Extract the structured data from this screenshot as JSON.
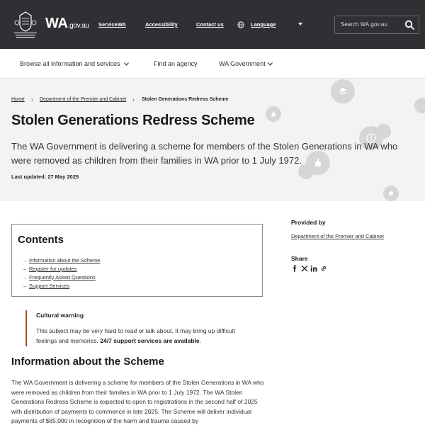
{
  "header": {
    "logo_main": "WA",
    "logo_suffix": ".gov.au",
    "links": [
      "ServiceWA",
      "Accessibility",
      "Contact us",
      "Language"
    ],
    "search_placeholder": "Search WA.gov.au",
    "colors": {
      "bar": "#2f3034",
      "text": "#ffffff"
    }
  },
  "subnav": {
    "items": [
      "Browse all information and services",
      "Find an agency",
      "WA Government"
    ]
  },
  "breadcrumb": {
    "items": [
      "Home",
      "Department of the Premier and Cabinet",
      "Stolen Generations Redress Scheme"
    ]
  },
  "hero": {
    "title": "Stolen Generations Redress Scheme",
    "lead": "The WA Government is delivering a scheme for members of the Stolen Generations in WA who were removed as children from their families in WA prior to 1 July 1972.",
    "updated": "Last updated: 27 May 2025"
  },
  "contents": {
    "title": "Contents",
    "items": [
      "Information about the Scheme",
      "Register for updates",
      "Frequently Asked Questions",
      "Support Services"
    ]
  },
  "warning": {
    "title": "Cultural warning",
    "body": "This subject may be very hard to read or talk about. It may bring up difficult feelings and memories.",
    "link": "24/7 support services are available",
    "accent": "#b8492a"
  },
  "section": {
    "title": "Information about the Scheme",
    "body": "The WA Government is delivering a scheme for members of the Stolen Generations in WA who were removed as children from their families in WA prior to 1 July 1972. The WA Stolen Generations Redress Scheme is expected to open to registrations in the second half of 2025 with distribution of payments to commence in late 2025. The Scheme will deliver individual payments of $85,000 in recognition of the harm and trauma caused by"
  },
  "sidebar": {
    "provided_by_label": "Provided by",
    "provided_by_link": "Department of the Premier and Cabinet",
    "share_label": "Share",
    "share_icons": [
      "facebook-icon",
      "x-icon",
      "linkedin-icon",
      "link-icon"
    ]
  }
}
